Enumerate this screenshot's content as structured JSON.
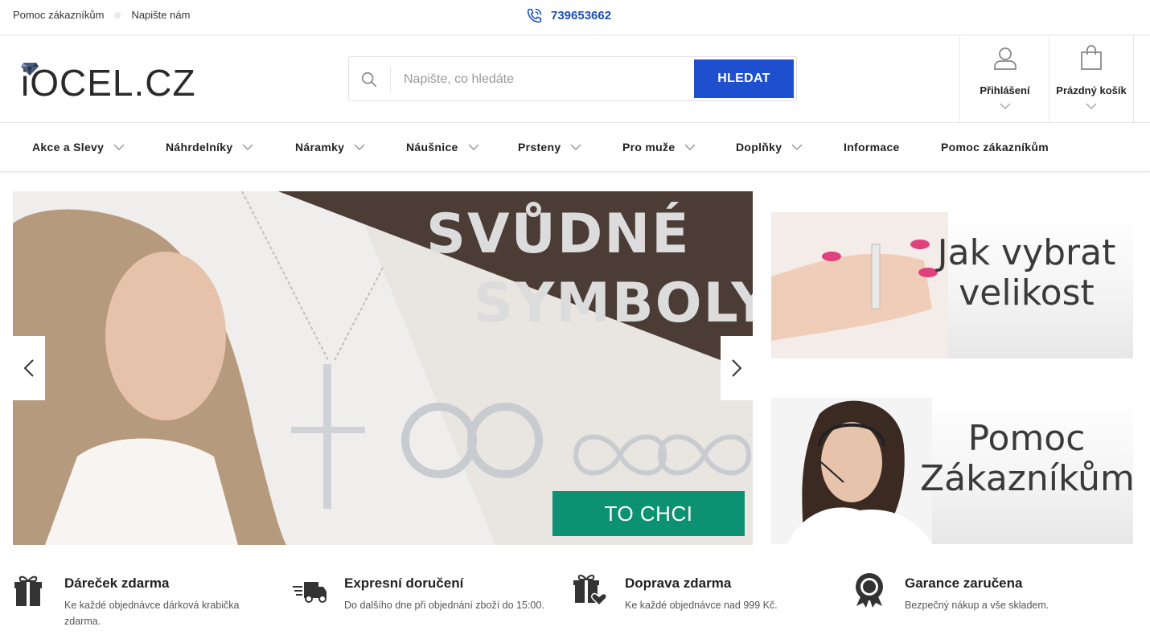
{
  "topbar": {
    "help_link": "Pomoc zákazníkům",
    "write_link": "Napište nám",
    "phone": "739653662"
  },
  "header": {
    "logo": "iOCEL.CZ",
    "search_placeholder": "Napište, co hledáte",
    "search_button": "HLEDAT",
    "login_label": "Přihlášení",
    "cart_label": "Prázdný košík"
  },
  "nav": {
    "items": [
      {
        "label": "Akce a Slevy"
      },
      {
        "label": "Náhrdelníky"
      },
      {
        "label": "Náramky"
      },
      {
        "label": "Náušnice"
      },
      {
        "label": "Prsteny"
      },
      {
        "label": "Pro muže"
      },
      {
        "label": "Doplňky"
      },
      {
        "label": "Informace"
      },
      {
        "label": "Pomoc zákazníkům"
      }
    ]
  },
  "hero": {
    "headline_1": "SVŮDNÉ",
    "headline_2": "SYMBOLY",
    "cta": "TO CHCI"
  },
  "side_banners": [
    {
      "line_1": "Jak vybrat",
      "line_2": "velikost"
    },
    {
      "line_1": "Pomoc",
      "line_2": "Zákazníkům"
    }
  ],
  "features": [
    {
      "icon": "gift-icon",
      "title": "Dáreček zdarma",
      "desc": "Ke každé objednávce dárková krabička zdarma."
    },
    {
      "icon": "delivery-truck-icon",
      "title": "Expresní doručení",
      "desc": "Do dalšího dne při objednání zboží do 15:00."
    },
    {
      "icon": "gift-heart-icon",
      "title": "Doprava zdarma",
      "desc": "Ke každé objednávce nad 999 Kč."
    },
    {
      "icon": "award-badge-icon",
      "title": "Garance zaručena",
      "desc": "Bezpečný nákup a vše skladem."
    }
  ],
  "colors": {
    "accent_blue": "#1e4fcf",
    "cta_green": "#0c9172",
    "banner_brown": "#4b3c35"
  }
}
